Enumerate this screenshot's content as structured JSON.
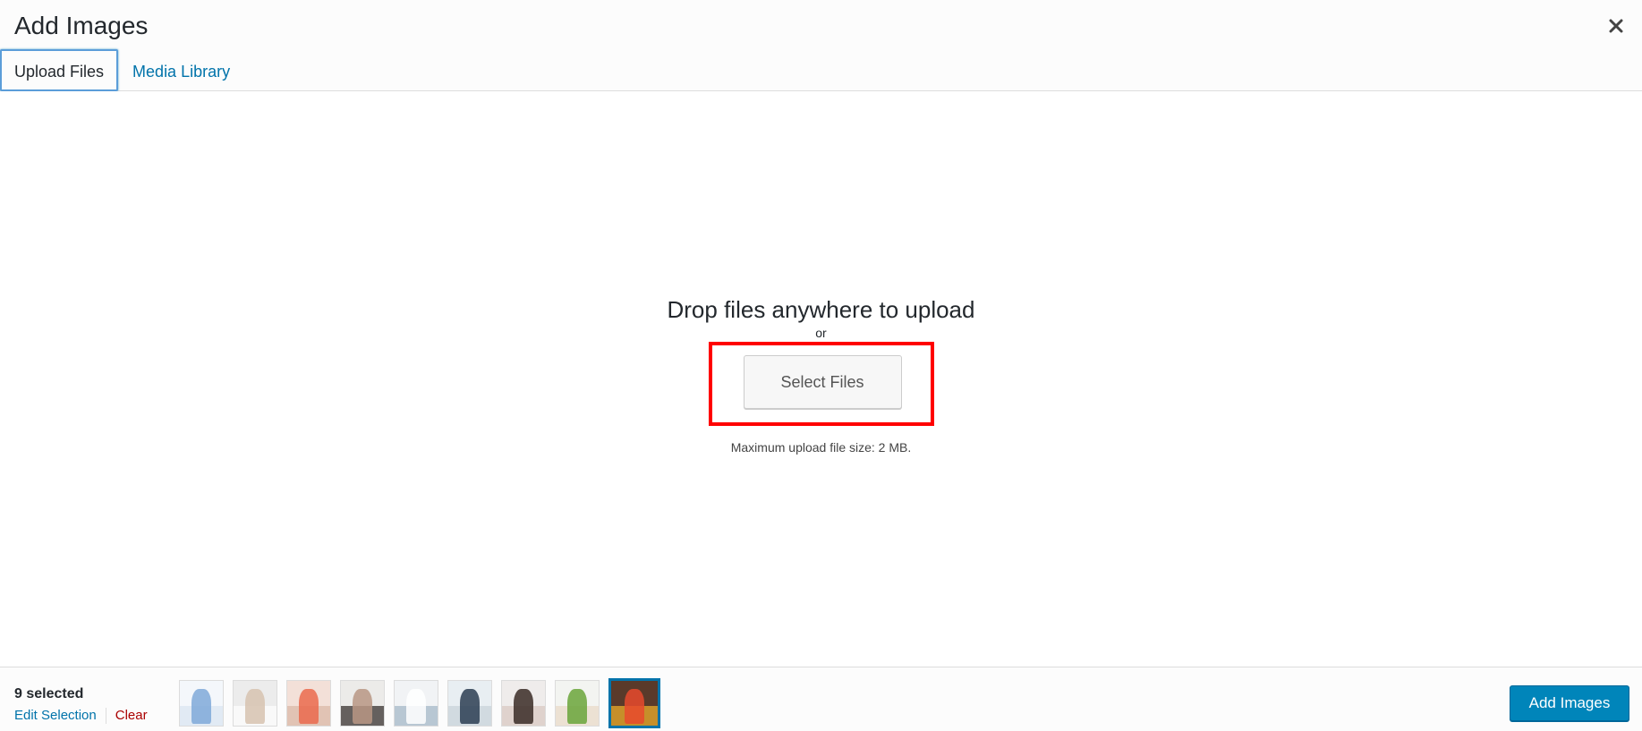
{
  "modal": {
    "title": "Add Images",
    "close_label": "×"
  },
  "tabs": [
    {
      "label": "Upload Files",
      "active": true
    },
    {
      "label": "Media Library",
      "active": false
    }
  ],
  "upload": {
    "drop_text": "Drop files anywhere to upload",
    "or_text": "or",
    "select_button": "Select Files",
    "max_size": "Maximum upload file size: 2 MB."
  },
  "footer": {
    "selected_count": "9 selected",
    "edit_selection": "Edit Selection",
    "clear": "Clear",
    "add_button": "Add Images",
    "thumbnails": [
      {
        "name": "thumb-diagram",
        "colors": [
          "#f4f7fb",
          "#7fa9d8",
          "#d9e4f1"
        ]
      },
      {
        "name": "thumb-women-white",
        "colors": [
          "#ececec",
          "#d7c3b0",
          "#ffffff"
        ]
      },
      {
        "name": "thumb-back-pain",
        "colors": [
          "#f3e0d8",
          "#ea6a4d",
          "#d9b7a5"
        ]
      },
      {
        "name": "thumb-neck-pain",
        "colors": [
          "#ecebe9",
          "#b99784",
          "#2c2522"
        ]
      },
      {
        "name": "thumb-doctor-patient",
        "colors": [
          "#f1f3f5",
          "#ffffff",
          "#9fb3c4"
        ]
      },
      {
        "name": "thumb-bed-man",
        "colors": [
          "#e8eef2",
          "#2b3d52",
          "#c7d1d9"
        ]
      },
      {
        "name": "thumb-woman-sitting",
        "colors": [
          "#efeceb",
          "#3a2b26",
          "#d8c8c0"
        ]
      },
      {
        "name": "thumb-food-woman",
        "colors": [
          "#f3f4f1",
          "#6aa53a",
          "#e8d8c6"
        ]
      },
      {
        "name": "thumb-fruits",
        "colors": [
          "#5a3a2a",
          "#e84a2d",
          "#f4b32b"
        ],
        "selected": true
      }
    ]
  },
  "colors": {
    "link": "#0073aa",
    "highlight_frame": "#ff0000",
    "primary_button": "#0085ba",
    "clear_link": "#aa0000"
  }
}
